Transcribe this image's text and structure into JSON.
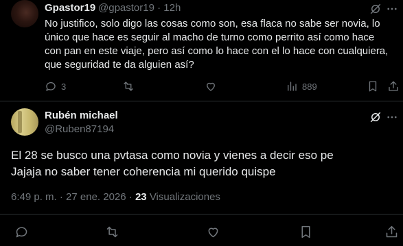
{
  "reply": {
    "author_name": "Gpastor19",
    "author_handle": "@gpastor19",
    "separator": "·",
    "time": "12h",
    "text": "No justifico, solo digo las cosas como son, esa flaca no sabe ser novia, lo único que hace es seguir al macho de turno como perrito así como hace con pan en este viaje, pero así como lo hace con el lo hace con cualquiera, que seguridad te da alguien así?",
    "replies_count": "3",
    "views_count": "889",
    "icons": [
      "grok-icon",
      "more-icon",
      "reply-icon",
      "retweet-icon",
      "like-icon",
      "views-icon",
      "bookmark-icon",
      "share-icon"
    ]
  },
  "main_tweet": {
    "author_name": "Rubén michael",
    "author_handle": "@Ruben87194",
    "text_line1": "El 28 se busco una pvtasa como novia y vienes a decir eso pe",
    "text_line2": "Jajaja no saber tener coherencia mi querido quispe",
    "timestamp": "6:49 p. m. · 27 ene. 2026 ·",
    "views_count": "23",
    "views_label": "Visualizaciones",
    "icons": [
      "grok-icon",
      "reply-icon",
      "retweet-icon",
      "like-icon",
      "bookmark-icon",
      "share-icon"
    ]
  },
  "colors": {
    "background": "#000000",
    "text": "#e7e9ea",
    "muted": "#71767b",
    "divider": "#2f3336"
  }
}
